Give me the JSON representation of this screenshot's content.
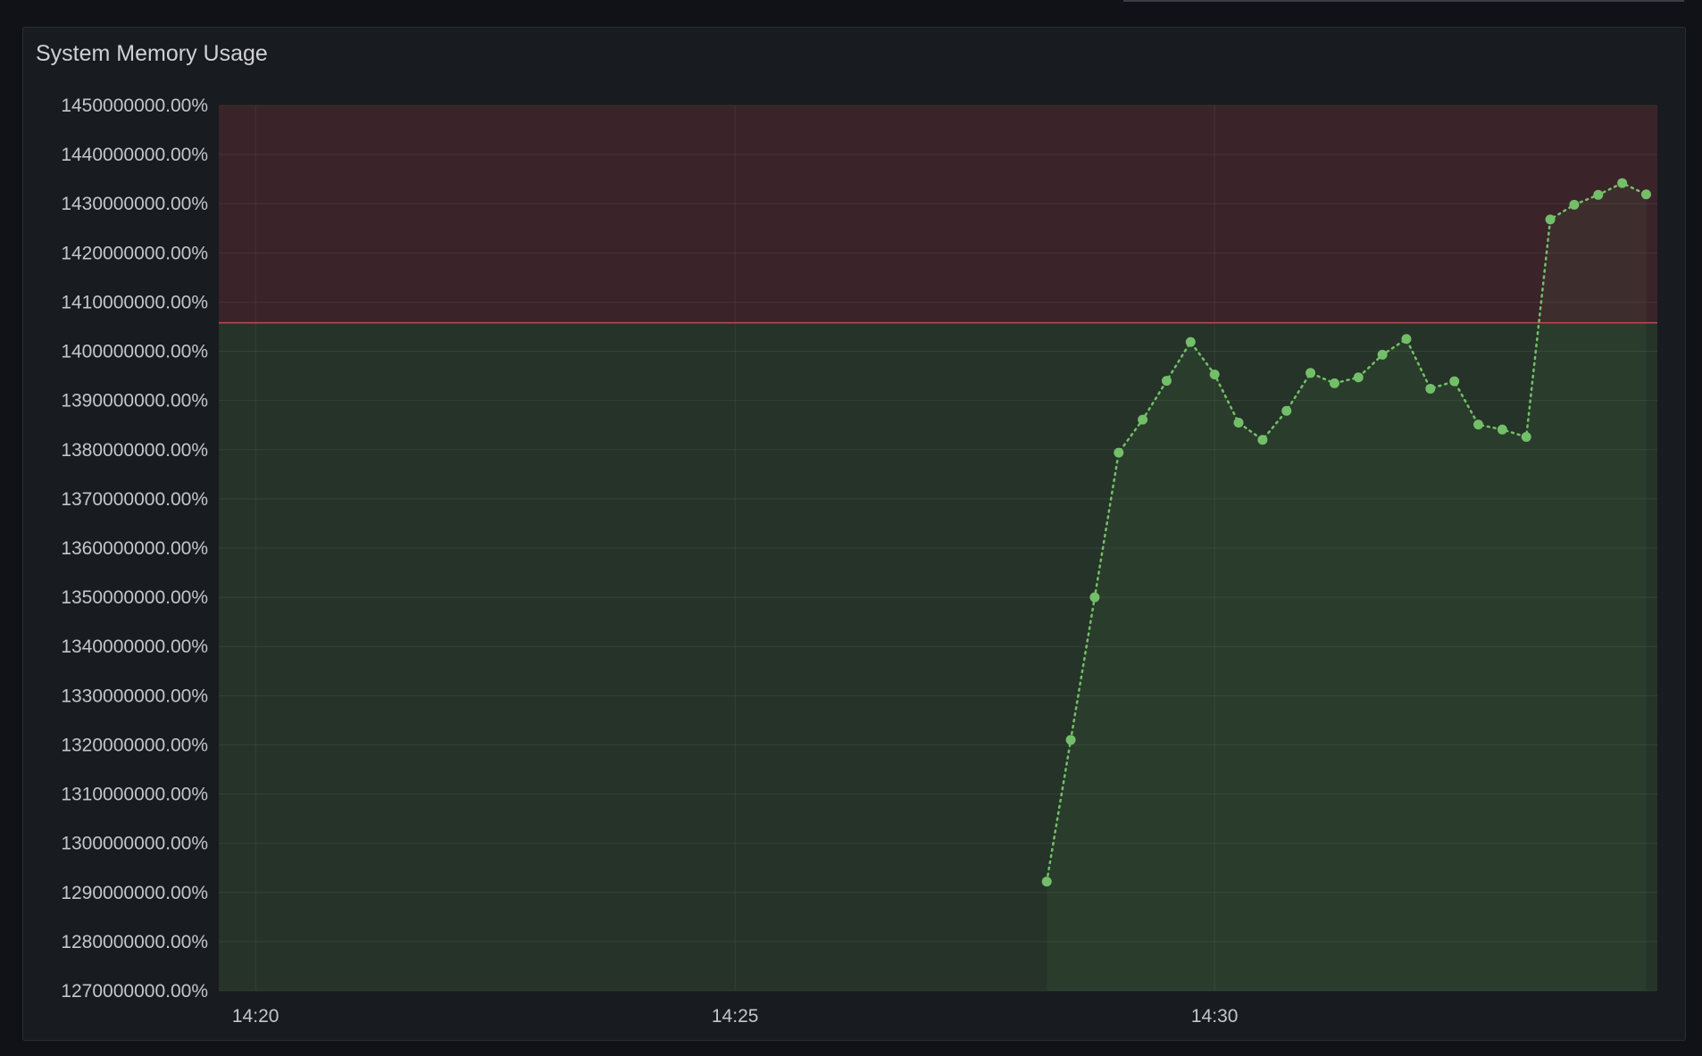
{
  "panel": {
    "title": "System Memory Usage"
  },
  "colors": {
    "background": "#111217",
    "panel_background": "#181b1f",
    "series": "#73bf69",
    "threshold_line": "#c4484e",
    "threshold_fill_ok": "#253328",
    "threshold_fill_critical": "#3a2329"
  },
  "chart_data": {
    "type": "line",
    "title": "System Memory Usage",
    "xlabel": "",
    "ylabel": "",
    "x_ticks": [
      "14:20",
      "14:25",
      "14:30"
    ],
    "x_range": [
      "14:19:37",
      "14:34:37"
    ],
    "y_ticks": [
      "1270000000.00%",
      "1280000000.00%",
      "1290000000.00%",
      "1300000000.00%",
      "1310000000.00%",
      "1320000000.00%",
      "1330000000.00%",
      "1340000000.00%",
      "1350000000.00%",
      "1360000000.00%",
      "1370000000.00%",
      "1380000000.00%",
      "1390000000.00%",
      "1400000000.00%",
      "1410000000.00%",
      "1420000000.00%",
      "1430000000.00%",
      "1440000000.00%",
      "1450000000.00%"
    ],
    "ylim": [
      1270000000,
      1450000000
    ],
    "y_unit": "%",
    "grid": true,
    "line_style": "dotted",
    "point_markers": true,
    "threshold": {
      "value": 1405800000,
      "below_color": "#253328",
      "above_color": "#3a2329",
      "line_color": "#c4484e"
    },
    "series": [
      {
        "color": "#73bf69",
        "x": [
          "14:28:15",
          "14:28:30",
          "14:28:45",
          "14:29:00",
          "14:29:15",
          "14:29:30",
          "14:29:45",
          "14:30:00",
          "14:30:15",
          "14:30:30",
          "14:30:45",
          "14:31:00",
          "14:31:15",
          "14:31:30",
          "14:31:45",
          "14:32:00",
          "14:32:15",
          "14:32:30",
          "14:32:45",
          "14:33:00",
          "14:33:15",
          "14:33:30",
          "14:33:45",
          "14:34:00",
          "14:34:15",
          "14:34:30"
        ],
        "values": [
          1292200000,
          1321000000,
          1350000000,
          1379400000,
          1386100000,
          1394000000,
          1401900000,
          1395300000,
          1385500000,
          1382000000,
          1387900000,
          1395600000,
          1393500000,
          1394700000,
          1399300000,
          1402500000,
          1392400000,
          1393900000,
          1385100000,
          1384100000,
          1382600000,
          1426800000,
          1429800000,
          1431800000,
          1434200000,
          1431900000
        ]
      }
    ]
  }
}
